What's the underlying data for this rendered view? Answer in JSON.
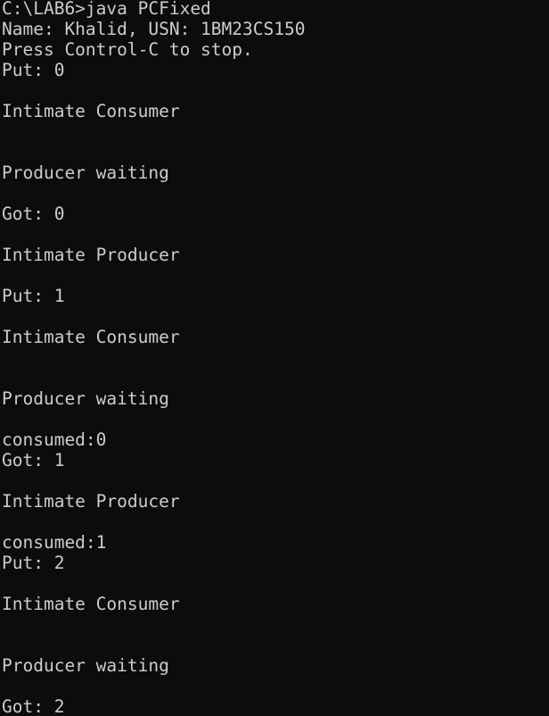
{
  "terminal": {
    "lines": [
      "C:\\LAB6>java PCFixed",
      "Name: Khalid, USN: 1BM23CS150",
      "Press Control-C to stop.",
      "Put: 0",
      "",
      "Intimate Consumer",
      "",
      "",
      "Producer waiting",
      "",
      "Got: 0",
      "",
      "Intimate Producer",
      "",
      "Put: 1",
      "",
      "Intimate Consumer",
      "",
      "",
      "Producer waiting",
      "",
      "consumed:0",
      "Got: 1",
      "",
      "Intimate Producer",
      "",
      "consumed:1",
      "Put: 2",
      "",
      "Intimate Consumer",
      "",
      "",
      "Producer waiting",
      "",
      "Got: 2"
    ]
  },
  "colors": {
    "background": "#0c0c0c",
    "text": "#cccccc"
  }
}
